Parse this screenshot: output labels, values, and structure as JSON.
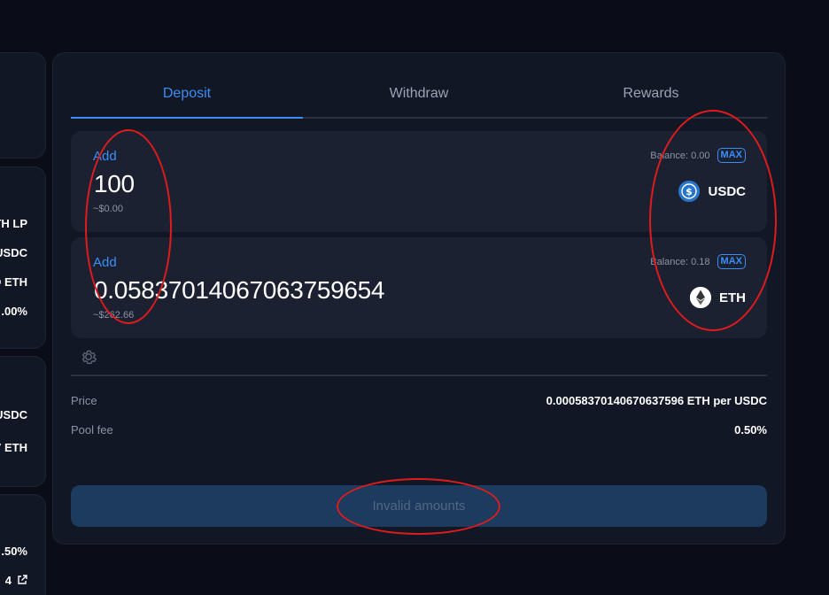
{
  "sidebar": {
    "card2_lines": [
      "TH LP",
      "USDC",
      "D ETH",
      ".00%"
    ],
    "card3_lines": [
      "USDC",
      "7 ETH"
    ],
    "card4_lines": [
      ".50%",
      "4"
    ]
  },
  "tabs": [
    {
      "label": "Deposit",
      "active": true
    },
    {
      "label": "Withdraw",
      "active": false
    },
    {
      "label": "Rewards",
      "active": false
    }
  ],
  "deposit": {
    "token_a": {
      "action_label": "Add",
      "amount": "100",
      "usd_value": "~$0.00",
      "balance": "Balance: 0.00",
      "max_label": "MAX",
      "symbol": "USDC",
      "icon": "usdc-icon"
    },
    "token_b": {
      "action_label": "Add",
      "amount": "0.0583701406706375965​4",
      "usd_value": "~$262.66",
      "balance": "Balance: 0.18",
      "max_label": "MAX",
      "symbol": "ETH",
      "icon": "eth-icon"
    }
  },
  "info": {
    "price_label": "Price",
    "price_value": "0.0005837014067063759​6 ETH per USDC",
    "fee_label": "Pool fee",
    "fee_value": "0.50%"
  },
  "submit_label": "Invalid amounts",
  "colors": {
    "accent": "#3a8ef6",
    "panel": "#121725",
    "token_box": "#1c2132",
    "button_disabled": "#1d3a5f",
    "annotation": "#e01b1b"
  }
}
